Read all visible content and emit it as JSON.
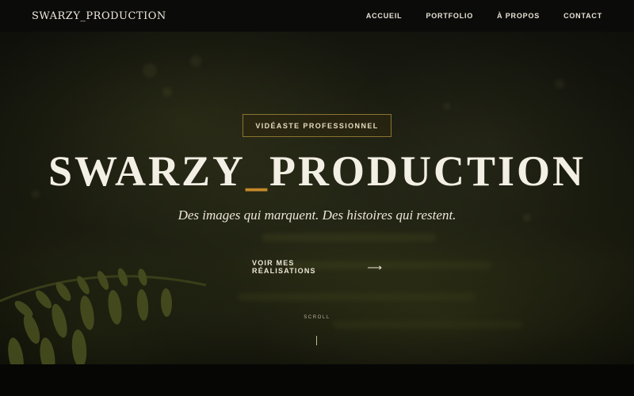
{
  "nav": {
    "brand": "SWARZY_PRODUCTION",
    "links": [
      "ACCUEIL",
      "PORTFOLIO",
      "À PROPOS",
      "CONTACT"
    ]
  },
  "hero": {
    "badge": "VIDÉASTE PROFESSIONNEL",
    "title_part1": "SWARZY",
    "title_underscore": "_",
    "title_part2": "PRODUCTION",
    "tagline": "Des images qui marquent. Des histoires qui restent.",
    "cta_label": "VOIR MES RÉALISATIONS",
    "cta_icon": "arrow-right-icon",
    "scroll_label": "SCROLL"
  },
  "colors": {
    "accent": "#c4892a",
    "badge_border": "#8c7430",
    "nav_bg": "#0b0b0a"
  }
}
